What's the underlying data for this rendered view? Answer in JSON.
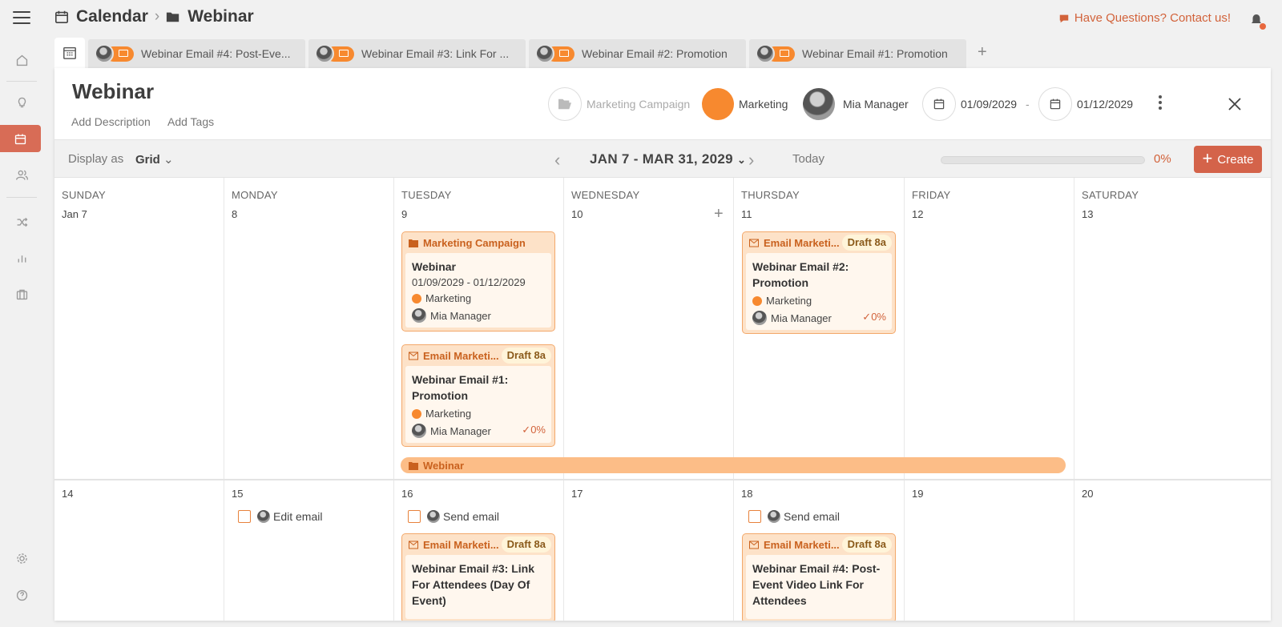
{
  "header": {
    "breadcrumb_root": "Calendar",
    "breadcrumb_current": "Webinar",
    "help_link": "Have Questions? Contact us!"
  },
  "tabs": [
    {
      "label": "Webinar Email #4: Post-Eve..."
    },
    {
      "label": "Webinar Email #3: Link For ..."
    },
    {
      "label": "Webinar Email #2: Promotion"
    },
    {
      "label": "Webinar Email #1: Promotion"
    }
  ],
  "panel": {
    "title": "Webinar",
    "add_description": "Add Description",
    "add_tags": "Add Tags",
    "campaign_placeholder": "Marketing Campaign",
    "team": "Marketing",
    "owner": "Mia Manager",
    "start_date": "01/09/2029",
    "date_separator": "-",
    "end_date": "01/12/2029"
  },
  "toolbar": {
    "display_as": "Display as",
    "view": "Grid",
    "range": "JAN 7 - MAR 31, 2029",
    "today": "Today",
    "progress_percent": 0,
    "progress_label": "0%",
    "create": "Create"
  },
  "calendar": {
    "day_names": [
      "SUNDAY",
      "MONDAY",
      "TUESDAY",
      "WEDNESDAY",
      "THURSDAY",
      "FRIDAY",
      "SATURDAY"
    ],
    "week1": [
      "Jan 7",
      "8",
      "9",
      "10",
      "11",
      "12",
      "13"
    ],
    "week2": [
      "14",
      "15",
      "16",
      "17",
      "18",
      "19",
      "20"
    ]
  },
  "cards": {
    "campaign": {
      "type": "Marketing Campaign",
      "title": "Webinar",
      "dates": "01/09/2029 - 01/12/2029",
      "team": "Marketing",
      "owner": "Mia Manager"
    },
    "email1": {
      "type": "Email Marketi...",
      "status": "Draft 8a",
      "title": "Webinar Email #1: Promotion",
      "team": "Marketing",
      "owner": "Mia Manager",
      "progress": "0%"
    },
    "email2": {
      "type": "Email Marketi...",
      "status": "Draft 8a",
      "title": "Webinar Email #2: Promotion",
      "team": "Marketing",
      "owner": "Mia Manager",
      "progress": "0%"
    },
    "email3": {
      "type": "Email Marketi...",
      "status": "Draft 8a",
      "title": "Webinar Email #3: Link For Attendees (Day Of Event)"
    },
    "email4": {
      "type": "Email Marketi...",
      "status": "Draft 8a",
      "title": "Webinar Email #4: Post-Event Video Link For Attendees"
    }
  },
  "campaign_bar": {
    "label": "Webinar"
  },
  "tasks": {
    "t15": "Edit email",
    "t16": "Send email",
    "t18": "Send email"
  },
  "colors": {
    "accent": "#d4634a",
    "brand_orange": "#f7892f",
    "card_bg": "#fde2c8",
    "bar_bg": "#fcbd87"
  }
}
